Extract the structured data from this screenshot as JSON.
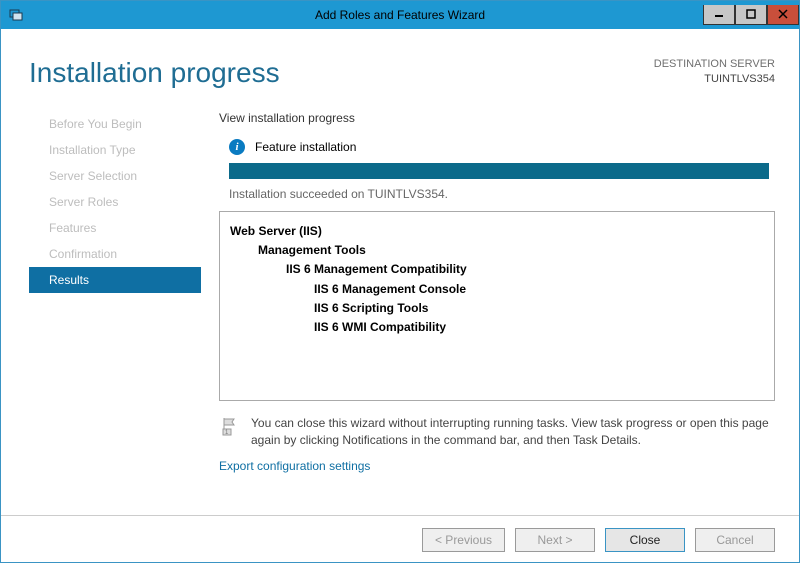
{
  "window": {
    "title": "Add Roles and Features Wizard"
  },
  "header": {
    "page_title": "Installation progress",
    "dest_label": "DESTINATION SERVER",
    "dest_server": "TUINTLVS354"
  },
  "sidebar": {
    "items": [
      {
        "label": "Before You Begin"
      },
      {
        "label": "Installation Type"
      },
      {
        "label": "Server Selection"
      },
      {
        "label": "Server Roles"
      },
      {
        "label": "Features"
      },
      {
        "label": "Confirmation"
      },
      {
        "label": "Results"
      }
    ],
    "active_index": 6
  },
  "content": {
    "view_label": "View installation progress",
    "status_label": "Feature installation",
    "succeeded_text": "Installation succeeded on TUINTLVS354.",
    "tree": {
      "root": "Web Server (IIS)",
      "l1": "Management Tools",
      "l2": "IIS 6 Management Compatibility",
      "l3a": "IIS 6 Management Console",
      "l3b": "IIS 6 Scripting Tools",
      "l3c": "IIS 6 WMI Compatibility"
    },
    "note": "You can close this wizard without interrupting running tasks. View task progress or open this page again by clicking Notifications in the command bar, and then Task Details.",
    "export_link": "Export configuration settings"
  },
  "footer": {
    "previous": "< Previous",
    "next": "Next >",
    "close": "Close",
    "cancel": "Cancel"
  }
}
